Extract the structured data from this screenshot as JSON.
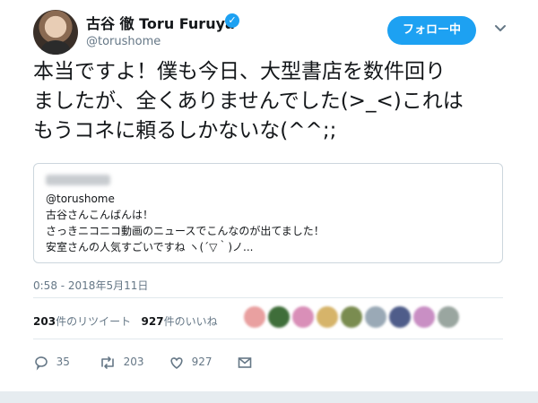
{
  "user": {
    "display_name": "古谷 徹 Toru Furuya",
    "handle": "@torushome",
    "follow_label": "フォロー中"
  },
  "tweet": {
    "lines": [
      "本当ですよ！僕も今日、大型書店を数件回り",
      "ましたが、全くありませんでした(>_<)これは",
      "もうコネに頼るしかないな(^^;;"
    ]
  },
  "quoted_tweet": {
    "handle": "@torushome",
    "lines": [
      "古谷さんこんばんは！",
      "さっきニコニコ動画のニュースでこんなのが出てました！",
      "安室さんの人気すごいですね ヽ(´▽｀)ノ..."
    ]
  },
  "timestamp": "0:58 - 2018年5月11日",
  "stats": {
    "retweet_count": "203",
    "retweet_label": "件のリツイート",
    "like_count": "927",
    "like_label": "件のいいね"
  },
  "liker_avatar_colors": [
    "#e9a0a0",
    "#3f6e3a",
    "#d98fb8",
    "#d6b46a",
    "#7a8c50",
    "#9aa9b6",
    "#4f5d8a",
    "#c98fc4",
    "#9aa6a0"
  ],
  "actions": {
    "reply_count": "35",
    "retweet_count": "203",
    "like_count": "927"
  },
  "colors": {
    "accent": "#1da1f2",
    "secondary_text": "#657786",
    "border": "#e1e8ed"
  }
}
